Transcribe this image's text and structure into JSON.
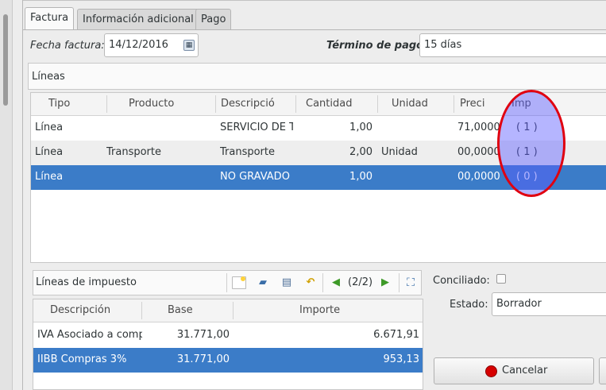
{
  "tabs": [
    {
      "label": "Factura",
      "active": true
    },
    {
      "label": "Información adicional",
      "active": false
    },
    {
      "label": "Pago",
      "active": false
    }
  ],
  "invoice": {
    "date_label": "Fecha factura:",
    "date_value": "14/12/2016",
    "payment_term_label": "Término de pago:",
    "payment_term_value": "15 días"
  },
  "lines": {
    "title": "Líneas",
    "columns": [
      "Tipo",
      "Producto",
      "Descripció",
      "Cantidad",
      "Unidad",
      "Preci",
      "Imp"
    ],
    "rows": [
      {
        "tipo": "Línea",
        "producto": "",
        "descripcion": "SERVICIO DE T",
        "cantidad": "1,00",
        "unidad": "",
        "precio": "71,0000",
        "imp": "( 1 )",
        "state": "normal"
      },
      {
        "tipo": "Línea",
        "producto": "Transporte",
        "descripcion": "Transporte",
        "cantidad": "2,00",
        "unidad": "Unidad",
        "precio": "00,0000",
        "imp": "( 1 )",
        "state": "alt"
      },
      {
        "tipo": "Línea",
        "producto": "",
        "descripcion": "NO GRAVADO",
        "cantidad": "1,00",
        "unidad": "",
        "precio": "00,0000",
        "imp": "( 0 )",
        "state": "selected"
      }
    ]
  },
  "tax_lines": {
    "title": "Líneas de impuesto",
    "pager": "(2/2)",
    "columns": [
      "Descripción",
      "Base",
      "Importe"
    ],
    "rows": [
      {
        "descripcion": "IVA Asociado a comp",
        "base": "31.771,00",
        "importe": "6.671,91",
        "state": "normal"
      },
      {
        "descripcion": "IIBB Compras 3%",
        "base": "31.771,00",
        "importe": "953,13",
        "state": "selected"
      }
    ],
    "toolbar_icons": [
      "new-icon",
      "open-icon",
      "save-icon",
      "undo-icon",
      "previous-icon",
      "next-icon",
      "switch-view-icon"
    ]
  },
  "side": {
    "conciliado_label": "Conciliado:",
    "conciliado_checked": false,
    "estado_label": "Estado:",
    "estado_value": "Borrador",
    "cancel_label": "Cancelar"
  },
  "colors": {
    "selection": "#3b7cc8",
    "annotation_outline": "#e00010",
    "annotation_fill": "#5a5aff"
  }
}
